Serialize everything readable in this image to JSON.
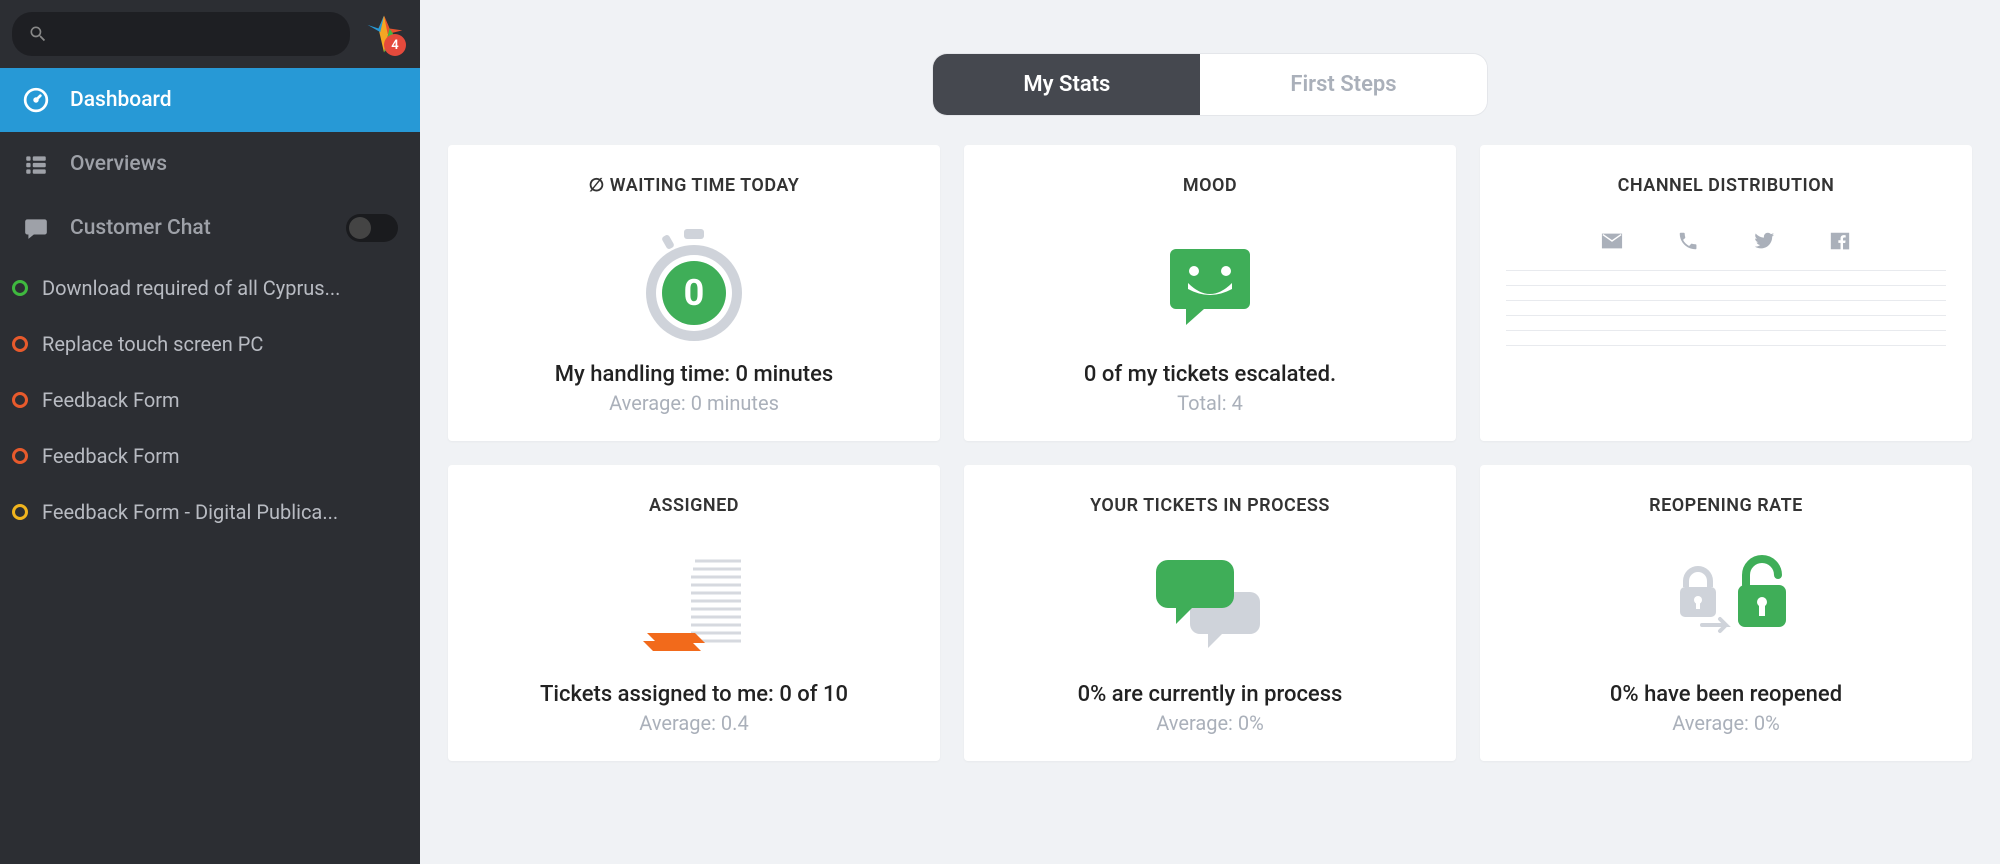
{
  "badge_count": "4",
  "nav": {
    "dashboard": "Dashboard",
    "overviews": "Overviews",
    "customer_chat": "Customer Chat"
  },
  "tickets": [
    {
      "label": "Download required of all Cyprus...",
      "color": "#3fb93f"
    },
    {
      "label": "Replace touch screen PC",
      "color": "#e85a2c"
    },
    {
      "label": "Feedback Form",
      "color": "#e85a2c"
    },
    {
      "label": "Feedback Form",
      "color": "#e85a2c"
    },
    {
      "label": "Feedback Form - Digital Publica...",
      "color": "#f0b41e"
    }
  ],
  "tabs": {
    "mystats": "My Stats",
    "firststeps": "First Steps"
  },
  "cards": {
    "waiting": {
      "title": "∅ WAITING TIME TODAY",
      "value": "0",
      "text": "My handling time: 0 minutes",
      "sub": "Average: 0 minutes"
    },
    "mood": {
      "title": "MOOD",
      "text": "0 of my tickets escalated.",
      "sub": "Total: 4"
    },
    "channel": {
      "title": "CHANNEL DISTRIBUTION"
    },
    "assigned": {
      "title": "ASSIGNED",
      "text": "Tickets assigned to me: 0 of 10",
      "sub": "Average: 0.4"
    },
    "inprocess": {
      "title": "YOUR TICKETS IN PROCESS",
      "text": "0% are currently in process",
      "sub": "Average: 0%"
    },
    "reopening": {
      "title": "REOPENING RATE",
      "text": "0% have been reopened",
      "sub": "Average: 0%"
    }
  }
}
